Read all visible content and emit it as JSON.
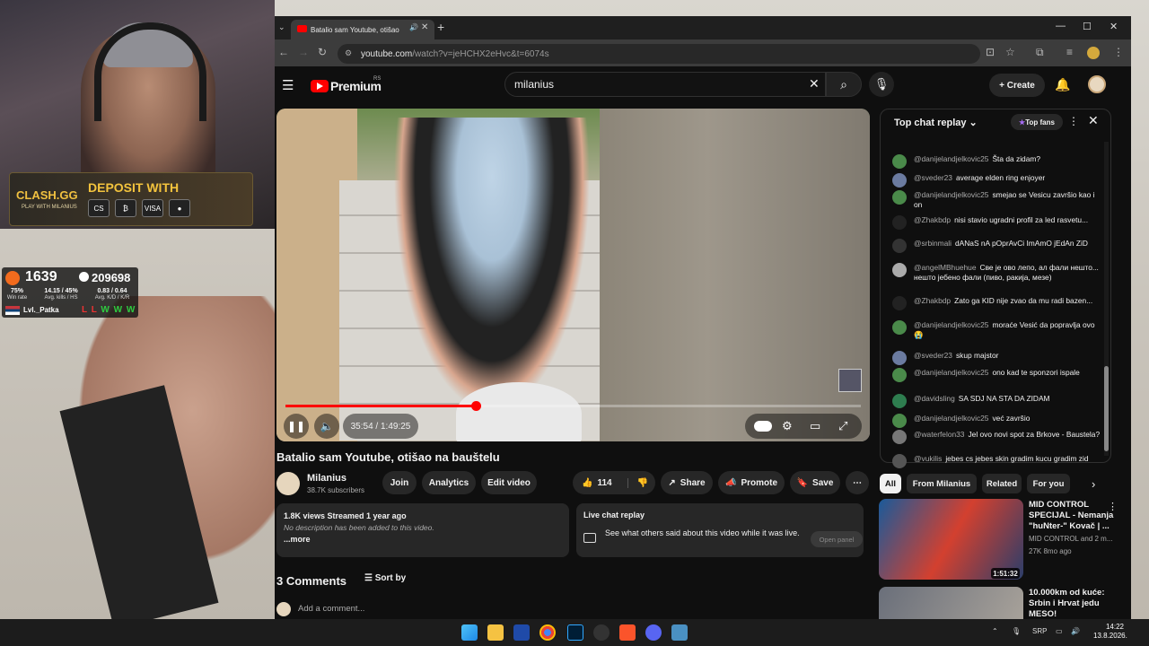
{
  "stream_overlay": {
    "clash_logo": "CLASH.GG",
    "clash_sub": "PLAY WITH MILANIUS",
    "deposit_text": "DEPOSIT WITH",
    "pay_methods": [
      "CS",
      "₿",
      "VISA",
      "●"
    ],
    "faceit_level": "1639",
    "elo": "209698",
    "winrate": "75%",
    "winrate_label": "Win rate",
    "avg_kills": "14.15 / 45%",
    "avg_kills_label": "Avg. kills / HS",
    "kd": "0.83 / 0.64",
    "kd_label": "Avg. K/D / K/R",
    "player_name": "Lvl._Patka",
    "form_losses": "L L",
    "form_wins": "W W W"
  },
  "browser": {
    "tab_title": "Batalio sam Youtube, otišao",
    "url_host": "youtube.com",
    "url_path": "/watch?v=jeHCHX2eHvc&t=6074s",
    "win_min": "—",
    "win_max": "☐",
    "win_close": "✕"
  },
  "youtube": {
    "brand": "Premium",
    "region": "RS",
    "search_value": "milanius",
    "create_label": "+ Create"
  },
  "player": {
    "progress": 0.33,
    "time_current": "35:54",
    "time_total": "1:49:25",
    "time_display": "35:54 / 1:49:25"
  },
  "video": {
    "title": "Batalio sam Youtube, otišao na bauštelu",
    "channel": "Milanius",
    "subscribers": "38.7K subscribers",
    "join": "Join",
    "analytics": "Analytics",
    "edit": "Edit video",
    "likes": "114",
    "share": "Share",
    "promote": "Promote",
    "save": "Save",
    "views": "1.8K views  Streamed 1 year ago",
    "description": "No description has been added to this video.",
    "more": "...more",
    "lcr_title": "Live chat replay",
    "lcr_text": "See what others said about this video while it was live.",
    "lcr_open": "Open panel",
    "comments_count": "3 Comments",
    "sort_by": "Sort by",
    "add_comment": "Add a comment..."
  },
  "chat": {
    "header": "Top chat replay",
    "top_fans": "Top fans",
    "messages": [
      {
        "author": "@danijelandjelkovic25",
        "text": "Šta da zidam?",
        "color": "#4a8a4a"
      },
      {
        "author": "@sveder23",
        "text": "average elden ring enjoyer",
        "color": "#6b7ba0"
      },
      {
        "author": "@danijelandjelkovic25",
        "text": "smejao se Vesicu završio kao i on",
        "color": "#4a8a4a"
      },
      {
        "author": "@Zhakbdp",
        "text": "nisi stavio ugradni profil za led rasvetu...",
        "color": "#222"
      },
      {
        "author": "@srbinmali",
        "text": "dANaS nA pOprAvCi ImAmO jEdAn ZiD",
        "color": "#333"
      },
      {
        "author": "@angelMBhuehue",
        "text": "Све је ово лепо, ал фали нешто... нешто јебено фали (пиво, ракија, мезе)",
        "color": "#aaa"
      },
      {
        "author": "@Zhakbdp",
        "text": "Zato ga KID nije zvao da mu radi bazen...",
        "color": "#222"
      },
      {
        "author": "@danijelandjelkovic25",
        "text": "moraće Vesić da popravlja ovo 😭",
        "color": "#4a8a4a"
      },
      {
        "author": "@sveder23",
        "text": "skup majstor",
        "color": "#6b7ba0"
      },
      {
        "author": "@danijelandjelkovic25",
        "text": "ono kad te sponzori ispale",
        "color": "#4a8a4a"
      },
      {
        "author": "@davidsling",
        "text": "SA SDJ NA STA DA ZIDAM",
        "color": "#2e7d4f"
      },
      {
        "author": "@danijelandjelkovic25",
        "text": "već završio",
        "color": "#4a8a4a"
      },
      {
        "author": "@waterfelon33",
        "text": "Jel ovo novi spot za Brkove - Baustela?",
        "color": "#777"
      },
      {
        "author": "@vukilis",
        "text": "jebes cs jebes skin gradim kucu gradim zid",
        "color": "#555"
      }
    ]
  },
  "related": {
    "chips": [
      "All",
      "From Milanius",
      "Related",
      "For you"
    ],
    "items": [
      {
        "title": "MID CONTROL SPECIJAL - Nemanja \"huNter-\" Kovač | ...",
        "channel": "MID CONTROL and 2 m...",
        "meta": "27K  8mo ago",
        "duration": "1:51:32"
      },
      {
        "title": "10.000km od kuće: Srbin i Hrvat jedu MESO!",
        "channel": "",
        "meta": "",
        "duration": ""
      }
    ]
  },
  "taskbar": {
    "lang": "SRP",
    "time": "14:22",
    "date": "13.8.2026."
  }
}
